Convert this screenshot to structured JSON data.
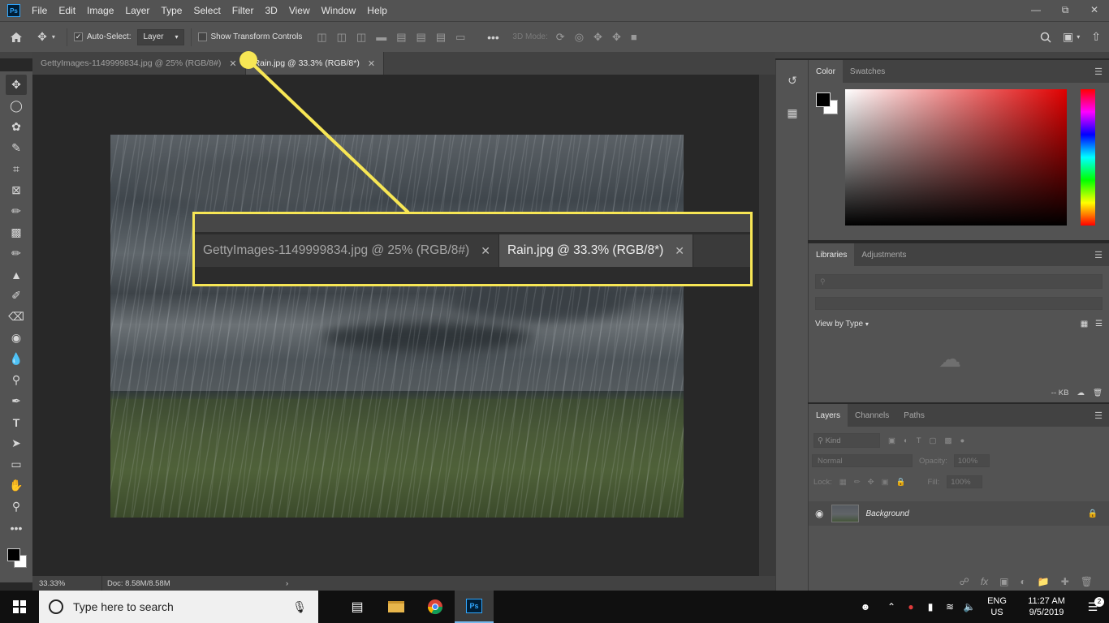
{
  "menubar": {
    "logo": "Ps",
    "items": [
      "File",
      "Edit",
      "Image",
      "Layer",
      "Type",
      "Select",
      "Filter",
      "3D",
      "View",
      "Window",
      "Help"
    ]
  },
  "options": {
    "auto_select_label": "Auto-Select:",
    "auto_select_value": "Layer",
    "show_transform_label": "Show Transform Controls",
    "three_d_label": "3D Mode:"
  },
  "tabs": [
    {
      "label": "GettyImages-1149999834.jpg @ 25% (RGB/8#)",
      "active": false
    },
    {
      "label": "Rain.jpg @ 33.3% (RGB/8*)",
      "active": true
    }
  ],
  "callout": {
    "tabs": [
      {
        "label": "GettyImages-1149999834.jpg @ 25% (RGB/8#)"
      },
      {
        "label": "Rain.jpg @ 33.3% (RGB/8*)"
      }
    ],
    "accent_color": "#f7e655"
  },
  "status": {
    "zoom": "33.33%",
    "doc": "Doc: 8.58M/8.58M"
  },
  "panels": {
    "color_tabs": [
      "Color",
      "Swatches"
    ],
    "library_tabs": [
      "Libraries",
      "Adjustments"
    ],
    "view_by": "View by Type",
    "kb": "-- KB",
    "layer_tabs": [
      "Layers",
      "Channels",
      "Paths"
    ],
    "kind_label": "Kind",
    "blend_mode": "Normal",
    "opacity_label": "Opacity:",
    "opacity_value": "100%",
    "lock_label": "Lock:",
    "fill_label": "Fill:",
    "fill_value": "100%",
    "layer_name": "Background"
  },
  "taskbar": {
    "search_placeholder": "Type here to search",
    "lang_top": "ENG",
    "lang_bottom": "US",
    "time": "11:27 AM",
    "date": "9/5/2019",
    "notifications": "2"
  }
}
